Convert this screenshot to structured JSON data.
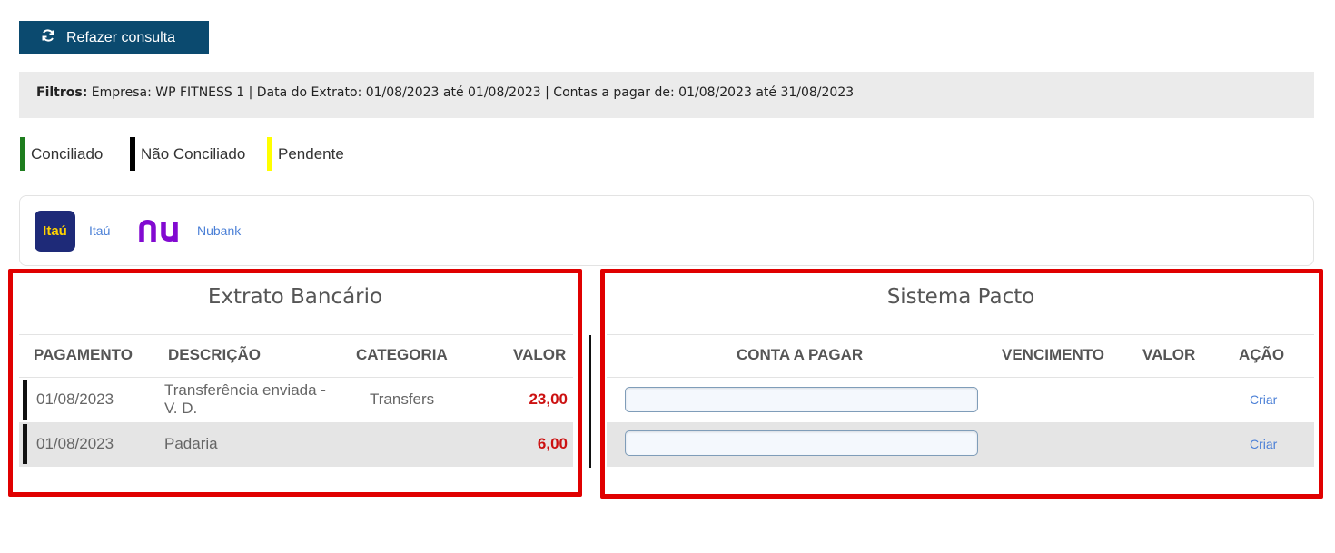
{
  "toolbar": {
    "refazer_label": "Refazer consulta",
    "refazer_icon": "refresh-icon",
    "button_color": "#0b4a6f"
  },
  "filters": {
    "label": "Filtros:",
    "text": "Empresa: WP FITNESS 1 | Data do Extrato: 01/08/2023 até 01/08/2023 | Contas a pagar de: 01/08/2023 até 31/08/2023"
  },
  "legend": [
    {
      "label": "Conciliado",
      "color": "#1e7d1e"
    },
    {
      "label": "Não Conciliado",
      "color": "#000000"
    },
    {
      "label": "Pendente",
      "color": "#ffff00"
    }
  ],
  "banks": [
    {
      "name": "Itaú",
      "logo_text": "Itaú",
      "icon": "itau-logo"
    },
    {
      "name": "Nubank",
      "logo_text": "nu",
      "icon": "nubank-logo"
    }
  ],
  "extrato": {
    "title": "Extrato Bancário",
    "headers": {
      "pagamento": "PAGAMENTO",
      "descricao": "DESCRIÇÃO",
      "categoria": "CATEGORIA",
      "valor": "VALOR"
    },
    "rows": [
      {
        "data": "01/08/2023",
        "descricao_l1": "Transferência enviada -",
        "descricao_l2": "V. D.",
        "categoria": "Transfers",
        "valor": "23,00"
      },
      {
        "data": "01/08/2023",
        "descricao_l1": "Padaria",
        "descricao_l2": "",
        "categoria": "",
        "valor": "6,00"
      }
    ]
  },
  "sistema": {
    "title": "Sistema Pacto",
    "headers": {
      "conta": "CONTA A PAGAR",
      "vencimento": "VENCIMENTO",
      "valor": "VALOR",
      "acao": "AÇÃO"
    },
    "rows": [
      {
        "conta_value": "",
        "vencimento": "",
        "valor": "",
        "acao": "Criar"
      },
      {
        "conta_value": "",
        "vencimento": "",
        "valor": "",
        "acao": "Criar"
      }
    ]
  },
  "colors": {
    "highlight_box": "#e00000",
    "value_red": "#cc1111",
    "link_blue": "#4a7fd6"
  }
}
